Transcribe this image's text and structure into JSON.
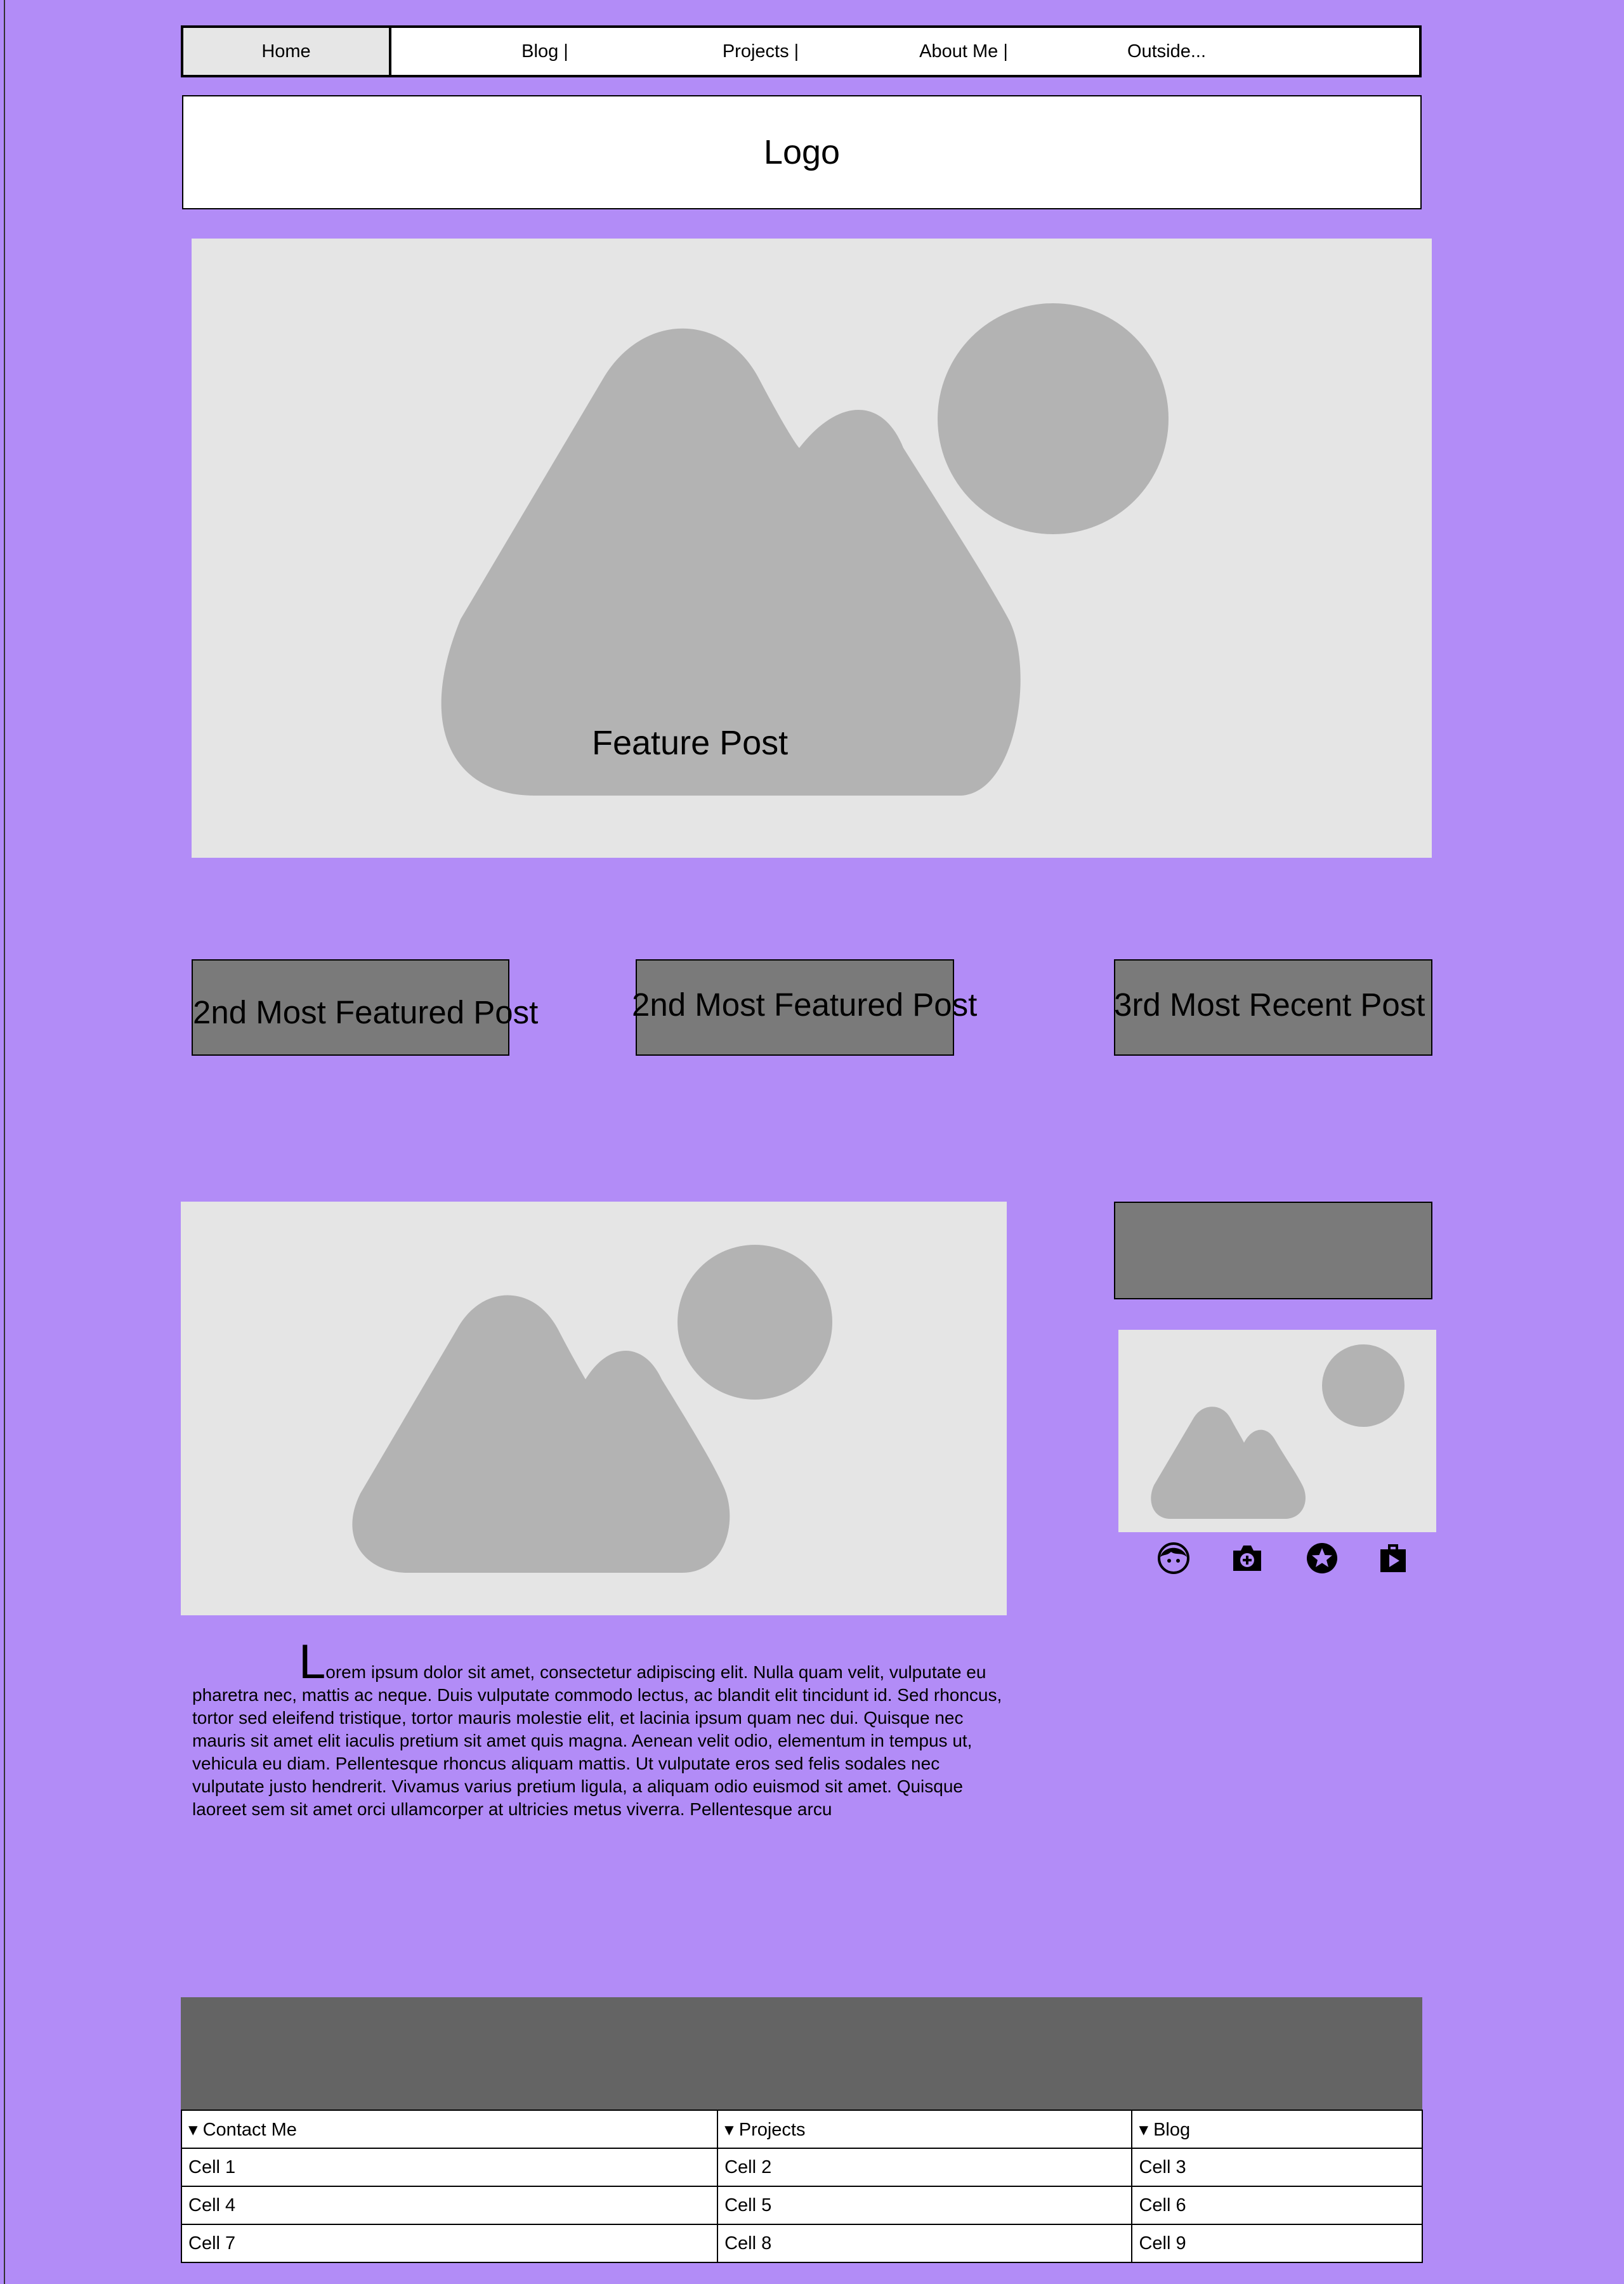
{
  "nav": {
    "items": [
      {
        "label": "Home"
      },
      {
        "label": "Blog |"
      },
      {
        "label": "Projects |"
      },
      {
        "label": "About Me |"
      },
      {
        "label": "Outside..."
      }
    ]
  },
  "logo": {
    "text": "Logo"
  },
  "feature": {
    "label": "Feature Post"
  },
  "posts": [
    {
      "label": "2nd Most Featured Post"
    },
    {
      "label": "2nd Most Featured Post"
    },
    {
      "label": "3rd Most Recent Post"
    }
  ],
  "article": {
    "dropcap": "L",
    "body": "orem ipsum dolor sit amet, consectetur adipiscing elit. Nulla quam velit, vulputate eu pharetra nec, mattis ac neque. Duis vulputate commodo lectus, ac blandit elit tincidunt id. Sed rhoncus, tortor sed eleifend tristique, tortor mauris molestie elit, et lacinia ipsum quam nec dui. Quisque nec mauris sit amet elit iaculis pretium sit amet quis magna. Aenean velit odio, elementum in tempus ut, vehicula eu diam. Pellentesque rhoncus aliquam mattis. Ut vulputate eros sed felis sodales nec vulputate justo hendrerit. Vivamus varius pretium ligula, a aliquam odio euismod sit amet. Quisque laoreet sem sit amet orci ullamcorper at ultricies metus viverra. Pellentesque arcu"
  },
  "social_icons": [
    "face-icon",
    "camera-icon",
    "star-icon",
    "media-play-icon"
  ],
  "footer": {
    "headers": [
      "▾ Contact Me",
      "▾ Projects",
      "▾ Blog"
    ],
    "rows": [
      [
        "Cell 1",
        "Cell 2",
        "Cell 3"
      ],
      [
        "Cell 4",
        "Cell 5",
        "Cell 6"
      ],
      [
        "Cell 7",
        "Cell 8",
        "Cell 9"
      ]
    ]
  },
  "colors": {
    "background": "#b28cf7",
    "placeholder": "#e5e5e5",
    "placeholder_shape": "#b3b3b3",
    "post_box": "#7a7a7a",
    "footer_band": "#646464"
  }
}
